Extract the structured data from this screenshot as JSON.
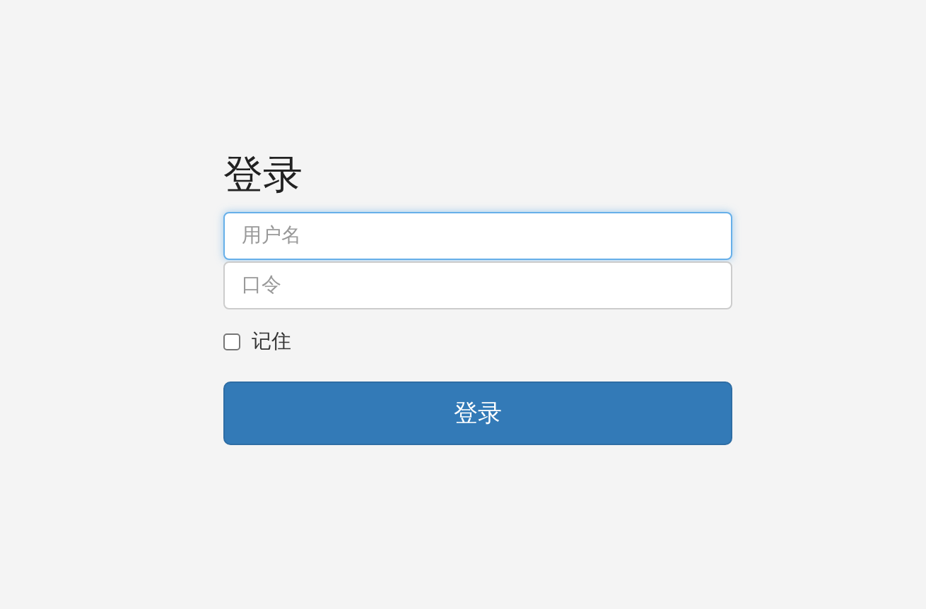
{
  "title": "登录",
  "fields": [
    {
      "placeholder": "用户名",
      "focused": true
    },
    {
      "placeholder": "口令",
      "focused": false
    }
  ],
  "remember": {
    "label": "记住",
    "checked": false
  },
  "submit": {
    "label": "登录"
  }
}
